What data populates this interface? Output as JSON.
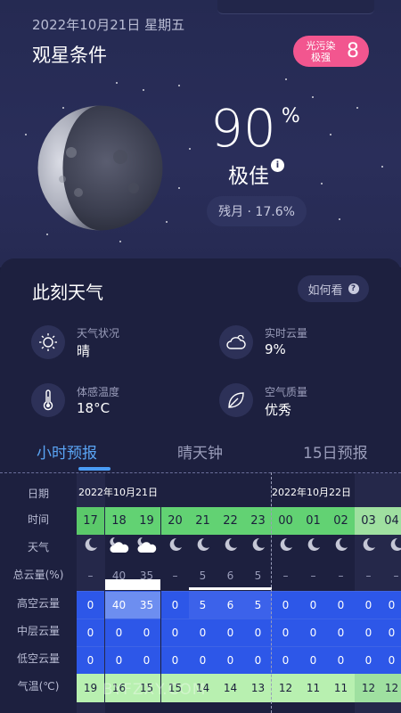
{
  "header": {
    "date": "2022年10月21日  星期五",
    "title": "观星条件",
    "light_pollution_label": "光污染\n极强",
    "light_pollution_value": "8"
  },
  "moon": {
    "percent": "90",
    "percent_sign": "%",
    "rating": "极佳",
    "info_icon": "info-icon",
    "phase": "残月 · 17.6%"
  },
  "weather": {
    "title": "此刻天气",
    "howto_label": "如何看",
    "items": [
      {
        "icon": "sun-icon",
        "label": "天气状况",
        "value": "晴"
      },
      {
        "icon": "cloud-icon",
        "label": "实时云量",
        "value": "9%"
      },
      {
        "icon": "thermometer-icon",
        "label": "体感温度",
        "value": "18°C"
      },
      {
        "icon": "leaf-icon",
        "label": "空气质量",
        "value": "优秀"
      }
    ]
  },
  "tabs": [
    {
      "label": "小时预报",
      "active": true
    },
    {
      "label": "晴天钟",
      "active": false
    },
    {
      "label": "15日预报",
      "active": false
    }
  ],
  "forecast": {
    "row_labels": [
      "日期",
      "时间",
      "天气",
      "总云量(%)",
      "高空云量",
      "中层云量",
      "低空云量",
      "气温(℃)"
    ],
    "date_1": "2022年10月21日",
    "date_2": "2022年10月22日",
    "hours": [
      "17",
      "18",
      "19",
      "20",
      "21",
      "22",
      "23",
      "00",
      "01",
      "02",
      "03",
      "04"
    ],
    "total_cloud": [
      "–",
      "40",
      "35",
      "–",
      "5",
      "6",
      "5",
      "–",
      "–",
      "–",
      "–",
      "–"
    ],
    "high_cloud": [
      "0",
      "40",
      "35",
      "0",
      "5",
      "6",
      "5",
      "0",
      "0",
      "0",
      "0",
      "0"
    ],
    "mid_cloud": [
      "0",
      "0",
      "0",
      "0",
      "0",
      "0",
      "0",
      "0",
      "0",
      "0",
      "0",
      "0"
    ],
    "low_cloud": [
      "0",
      "0",
      "0",
      "0",
      "0",
      "0",
      "0",
      "0",
      "0",
      "0",
      "0",
      "0"
    ],
    "temperature": [
      "19",
      "16",
      "15",
      "15",
      "14",
      "14",
      "13",
      "12",
      "11",
      "11",
      "12",
      "12"
    ],
    "weather_icons": [
      "moon-icon",
      "moon-cloud-icon",
      "moon-cloud-icon",
      "moon-icon",
      "moon-icon",
      "moon-icon",
      "moon-icon",
      "moon-icon",
      "moon-icon",
      "moon-icon",
      "moon-icon",
      "moon-icon"
    ]
  },
  "watermark": "BYFZXY.COM"
}
